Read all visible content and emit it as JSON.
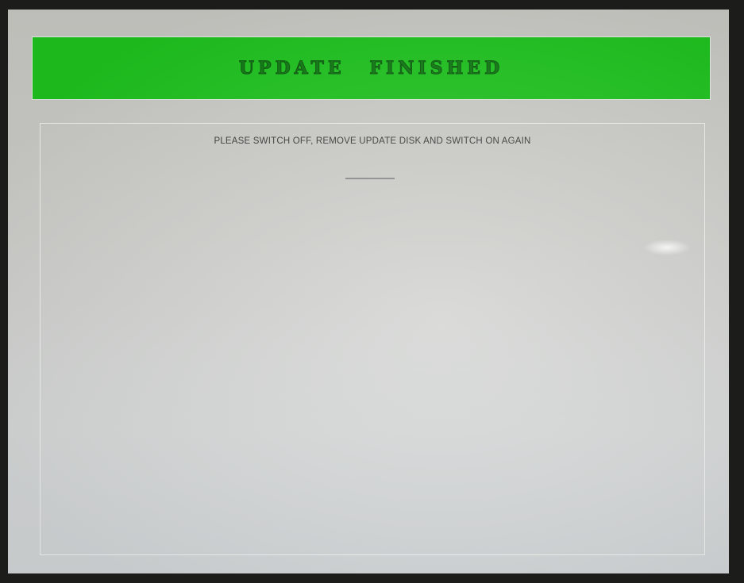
{
  "banner": {
    "title": "UPDATE FINISHED",
    "color": "#1ec41e"
  },
  "panel": {
    "message": "PLEASE SWITCH OFF, REMOVE UPDATE DISK AND SWITCH ON AGAIN"
  }
}
